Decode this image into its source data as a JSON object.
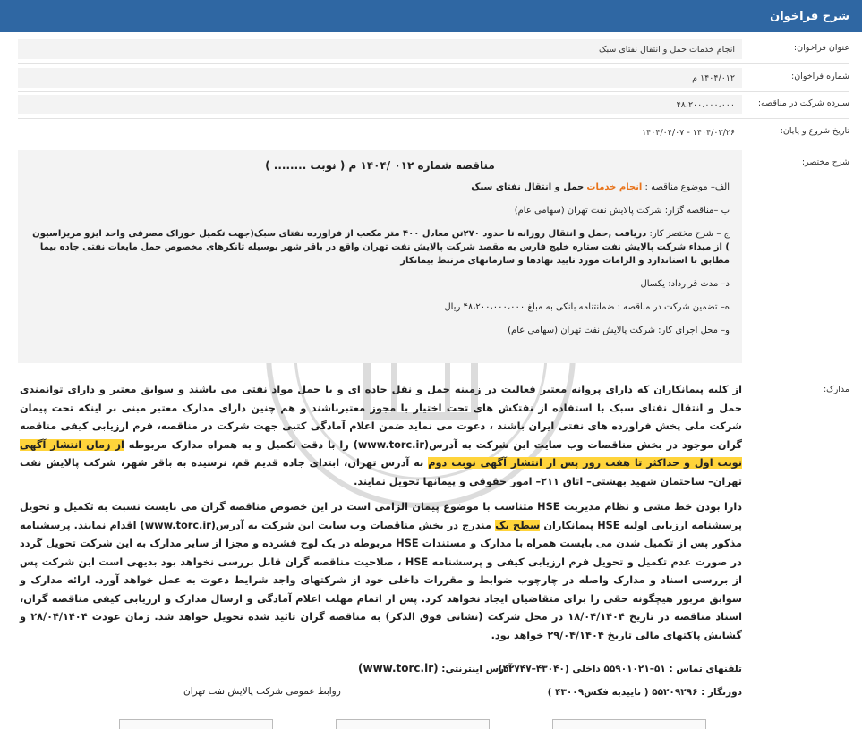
{
  "header": {
    "title": "شرح فراخوان"
  },
  "fields": {
    "title_label": "عنوان فراخوان:",
    "title_value": "انجام خدمات حمل و انتقال نفتای سبک",
    "number_label": "شماره فراخوان:",
    "number_value": "۱۴۰۴/۰۱۲ م",
    "deposit_label": "سپرده شرکت در مناقصه:",
    "deposit_value": "۴۸،۲۰۰،۰۰۰،۰۰۰",
    "dates_label": "تاریخ شروع و پایان:",
    "dates_value": "۱۴۰۴/۰۳/۲۶ - ۱۴۰۴/۰۴/۰۷",
    "summary_label": "شرح مختصر:",
    "docs_label": "مدارک:"
  },
  "summary": {
    "title": "مناقصه شماره ۰۱۲ /۱۴۰۴ م ( نوبت ........ )",
    "line_a_prefix": "الف– موضوع مناقصه :",
    "line_a_highlight": "انجام خدمات",
    "line_a_rest": "حمل و انتقال نفتای سبک",
    "line_b": "ب –مناقصه گزار: شرکت پالایش نفت تهران (سهامی عام)",
    "line_c_prefix": "ج – شرح مختصر کار:",
    "line_c_rest": "دریافت ,حمل و انتقال روزانه تا حدود ۲۷۰تن معادل ۴۰۰ متر مکعب از فراورده نفتای سبک(جهت تکمیل خوراک مصرفی واحد ایزو مریزاسیون ) از مبداء شرکت پالایش نفت ستاره خلیج فارس به مقصد شرکت پالایش نفت تهران واقع در باقر شهر بوسیله تانکرهای مخصوص حمل مایعات نفتی جاده پیما مطابق با استاندارد و الزامات مورد تایید نهادها و سازمانهای مرتبط بیمانکار",
    "line_d": "د– مدت قرارداد: یکسال",
    "line_e": "ه– تضمین شرکت در مناقصه : ضمانتنامه بانکی به مبلغ ۴۸،۲۰۰،۰۰۰،۰۰۰ ریال",
    "line_f": "و– محل اجرای کار: شرکت پالایش نفت تهران (سهامی عام)"
  },
  "docs": {
    "p1_a": "از کلیه پیمانکاران که دارای پروانه معتبر فعالیت در زمینه حمل و نقل جاده ای و یا حمل مواد نفتی می باشند و سوابق معتبر و دارای توانمندی حمل و انتقال نفتای سبک با استفاده از نفتکش های تحت اختیار با مجوز معتبرباشند و هم چنین دارای مدارک معتبر مبنی بر اینکه تحت پیمان شرکت ملی پخش فراورده های نفتی ایران باشند ، دعوت می نماید ضمن اعلام آمادگی کتبی جهت شرکت در مناقصه، فرم ارزیابی کیفی مناقصه گران موجود در بخش مناقصات وب سایت این شرکت به آدرس(www.torc.ir) را با دقت تکمیل و به همراه مدارک مربوطه",
    "p1_hl": "از زمان انتشار آگهی نوبت اول و حداکثر تا هفت روز پس از انتشار آگهی نوبت دوم",
    "p1_b": "به آدرس تهران، ابتدای جاده قدیم قم، نرسیده به باقر شهر، شرکت پالایش نفت تهران– ساختمان شهید بهشتی– اتاق ۲۱۱– امور حقوقی و پیمانها تحویل نمایند.",
    "p2_a": "دارا بودن خط مشی و نظام مدیریت HSE متناسب با موضوع پیمان الزامی است در این خصوص مناقصه گران می بایست نسبت به تکمیل و تحویل پرسشنامه ارزیابی اولیه HSE پیمانکاران",
    "p2_hl": "سطح یک",
    "p2_b": "مندرج در بخش مناقصات وب سایت این شرکت به آدرس(www.torc.ir) اقدام نمایند. پرسشنامه مذکور پس از تکمیل شدن می بایست همراه با مدارک و مستندات HSE مربوطه در یک لوح فشرده و مجزا از سایر مدارک به این شرکت تحویل گردد در صورت عدم تکمیل و تحویل فرم ارزیابی کیفی و پرسشنامه HSE ، صلاحیت مناقصه گران قابل بررسی نخواهد بود بدیهی است این شرکت پس از بررسی اسناد و مدارک واصله در چارچوب ضوابط و مقررات داخلی خود از شرکتهای واجد شرایط دعوت به عمل خواهد آورد. ارائه مدارک و سوابق مزبور هیچگونه حقی را برای متقاضیان ایجاد نخواهد کرد. پس از اتمام مهلت اعلام آمادگی و ارسال مدارک و ارزیابی کیفی مناقصه گران، اسناد مناقصه در تاریخ ۱۸/۰۴/۱۴۰۴ در محل شرکت (نشانی فوق الذکر) به مناقصه گران تائید شده تحویل خواهد شد. زمان عودت ۲۸/۰۴/۱۴۰۴ و گشایش پاکتهای مالی تاریخ ۲۹/۰۴/۱۴۰۴ خواهد بود."
  },
  "contact": {
    "phones": "تلفنهای تماس : ۵۱–۵۵۹۰۱۰۲۱ داخلی (۴۳۰۴۰–۴۲۷۴۷)",
    "website_label": "آدرس اینترنتی:",
    "website": "(www.torc.ir)",
    "fax": "دورنگار : ۵۵۲۰۹۲۹۶ ( تاییدیه فکس۴۳۰۰۹ )",
    "signature": "روابط عمومی شرکت پالایش نفت تهران"
  },
  "colors": {
    "header_bg": "#2f67a3",
    "highlight": "#ffd43b",
    "accent": "#e8731a"
  }
}
